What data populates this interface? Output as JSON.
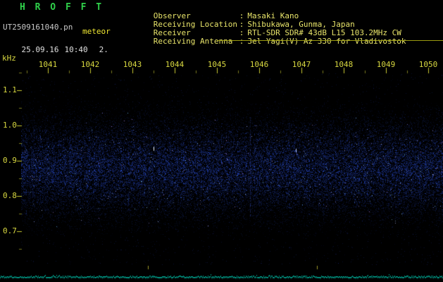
{
  "app": {
    "title": "H R O F F T"
  },
  "session": {
    "filename": "UT2509161040.pn",
    "mode_label": "meteor",
    "date": "25.09.16",
    "time": "10:40",
    "counter": "2."
  },
  "station": {
    "colon": ":",
    "rows": [
      {
        "label": "Observer",
        "value": "Masaki Kano"
      },
      {
        "label": "Receiving Location",
        "value": "Shibukawa, Gunma, Japan"
      },
      {
        "label": "Receiver",
        "value": "RTL-SDR SDR# 43dB L15 103.2MHz CW"
      },
      {
        "label": "Receiving Antenna",
        "value": "3el Yagi(V) Az 330 for Vladivostok"
      }
    ]
  },
  "spectrogram": {
    "y_unit": "kHz",
    "y_ticks": [
      "1.1",
      "1.0",
      "0.9",
      "0.8",
      "0.7"
    ],
    "x_ticks": [
      "1041",
      "1042",
      "1043",
      "1044",
      "1045",
      "1046",
      "1047",
      "1048",
      "1049",
      "1050"
    ],
    "colors": {
      "axis_yellow": "#c8c832",
      "noise_blue": "#2a3cc8",
      "level_teal": "#00c0aa",
      "title_green": "#2fd04a"
    }
  }
}
